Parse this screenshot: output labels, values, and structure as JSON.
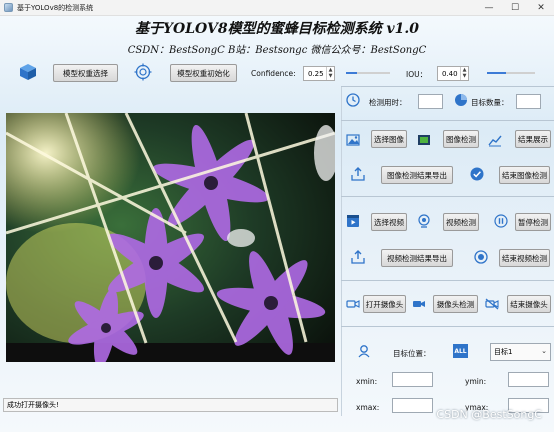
{
  "window": {
    "title": "基于YOLOv8的检测系统",
    "controls": {
      "minimize": "—",
      "maximize": "☐",
      "close": "✕"
    }
  },
  "header": {
    "title": "基于YOLOV8模型的蜜蜂目标检测系统 v1.0",
    "subtitle": "CSDN：BestSongC   B站：Bestsongc   微信公众号：BestSongC"
  },
  "toolbar": {
    "model_select_label": "模型权重选择",
    "model_init_label": "模型权重初始化",
    "confidence_label": "Confidence:",
    "confidence_value": "0.25",
    "confidence_slider_level": 0.25,
    "iou_label": "IOU：",
    "iou_value": "0.40",
    "iou_slider_level": 0.4
  },
  "stats": {
    "time_label": "检测用时：",
    "time_value": "",
    "count_label": "目标数量：",
    "count_value": ""
  },
  "image_section": {
    "select_label": "选择图像",
    "detect_label": "图像检测",
    "show_label": "结果展示",
    "export_label": "图像检测结果导出",
    "end_label": "结束图像检测"
  },
  "video_section": {
    "select_label": "选择视频",
    "detect_label": "视频检测",
    "pause_label": "暂停检测",
    "export_label": "视频检测结果导出",
    "end_label": "结束视频检测"
  },
  "camera_section": {
    "open_label": "打开摄像头",
    "detect_label": "摄像头检测",
    "end_label": "结束摄像头"
  },
  "location": {
    "label": "目标位置：",
    "all_badge": "ALL",
    "target_select_value": "目标1",
    "xmin_label": "xmin:",
    "ymin_label": "ymin:",
    "xmax_label": "xmax:",
    "ymax_label": "ymax:",
    "xmin_value": "",
    "ymin_value": "",
    "xmax_value": "",
    "ymax_value": ""
  },
  "status": {
    "message": "成功打开摄像头!"
  },
  "watermark": "CSDN @BestSongC",
  "colors": {
    "accent": "#3d7bd6",
    "icon_blue": "#2f74c9",
    "title_text": "#111111"
  },
  "icons": {
    "cube": "cube-icon",
    "target": "target-icon",
    "clock": "clock-icon",
    "pie": "pie-chart-icon",
    "image": "image-icon",
    "image_detect": "image-detect-icon",
    "chart": "line-chart-icon",
    "upload": "upload-icon",
    "check": "check-circle-icon",
    "video": "video-file-icon",
    "webcam": "webcam-icon",
    "pause": "pause-icon",
    "stop": "stop-icon",
    "camera": "camera-icon",
    "camera_off": "camera-off-icon",
    "person": "person-pin-icon"
  }
}
